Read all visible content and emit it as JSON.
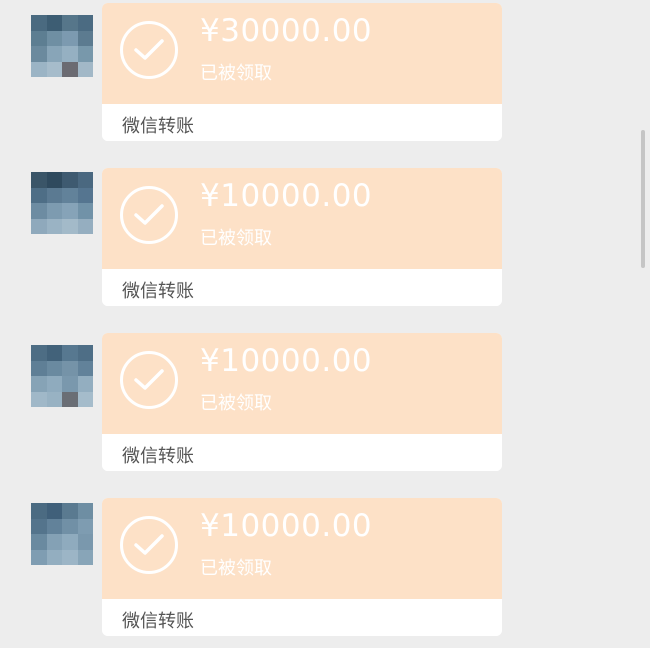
{
  "messages": [
    {
      "amount": "¥30000.00",
      "status": "已被领取",
      "source": "微信转账"
    },
    {
      "amount": "¥10000.00",
      "status": "已被领取",
      "source": "微信转账"
    },
    {
      "amount": "¥10000.00",
      "status": "已被领取",
      "source": "微信转账"
    },
    {
      "amount": "¥10000.00",
      "status": "已被领取",
      "source": "微信转账"
    }
  ],
  "colors": {
    "background": "#ededed",
    "card_top": "#fde1c7",
    "card_bottom": "#ffffff",
    "text_on_orange": "#ffffff",
    "source_text": "#555555"
  },
  "icons": {
    "check": "check-circle-icon",
    "avatar": "pixelated-avatar"
  }
}
